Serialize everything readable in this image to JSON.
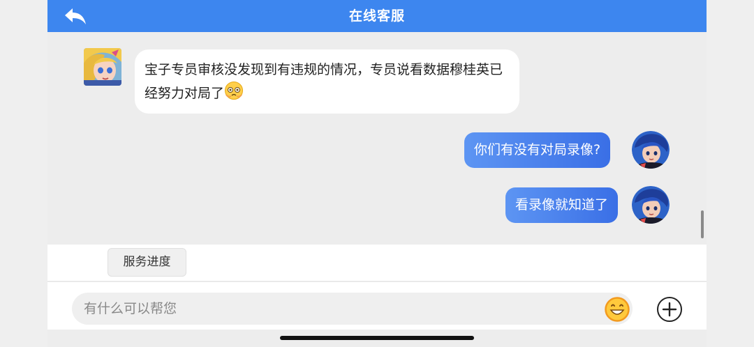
{
  "header": {
    "title": "在线客服",
    "back_icon": "back-arrow-icon"
  },
  "messages": [
    {
      "sender": "agent",
      "text": "宝子专员审核没发现到有违规的情况，专员说看数据穆桂英已经努力对局了",
      "trailing_icon": "pleading-face-emoji-icon"
    },
    {
      "sender": "user",
      "text": "你们有没有对局录像?"
    },
    {
      "sender": "user",
      "text": "看录像就知道了"
    }
  ],
  "quick_actions": {
    "service_progress_label": "服务进度"
  },
  "composer": {
    "placeholder": "有什么可以帮您",
    "emoji_icon": "smiley-icon",
    "plus_icon": "plus-circle-icon"
  },
  "colors": {
    "header": "#3d86ef",
    "user_bubble": "#4a80ee",
    "emoji": "#f5a623"
  }
}
